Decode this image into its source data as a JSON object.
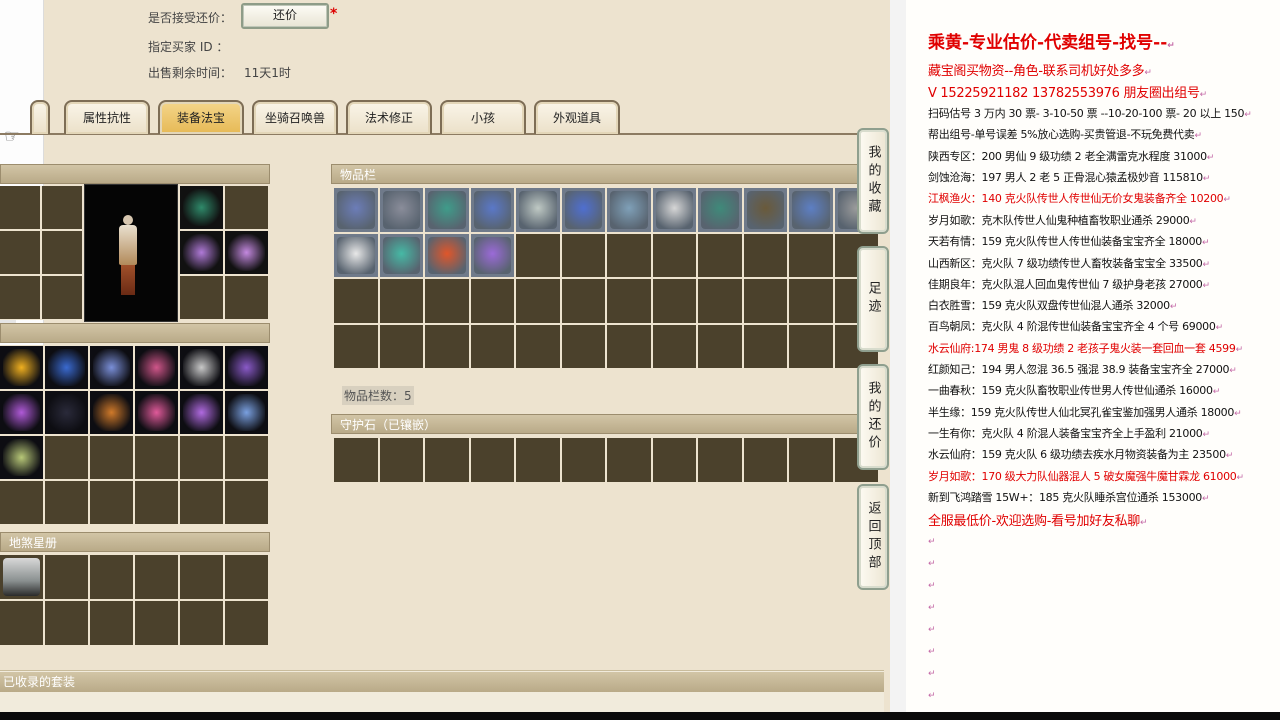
{
  "top_info": {
    "accept_counter_label": "是否接受还价：",
    "counter_button": "还价",
    "required_mark": "*",
    "buyer_id_label": "指定买家 ID ：",
    "time_left_label": "出售剩余时间：",
    "time_left_value": "11天1时"
  },
  "tabs": [
    "属性抗性",
    "装备法宝",
    "坐骑召唤兽",
    "法术修正",
    "小孩",
    "外观道具"
  ],
  "active_tab": "装备法宝",
  "panels": {
    "inventory_title": "物品栏",
    "inventory_count_label": "物品栏数：5",
    "guard_stone_title": "守护石（已镶嵌）",
    "earth_sha_title": "地煞星册",
    "collected_sets_title": "已收录的套装"
  },
  "side_buttons": [
    "我的收藏",
    "足迹",
    "我的还价",
    "返回顶部"
  ],
  "item_colors": {
    "inventory": [
      "#6c7db8",
      "#8a8d9a",
      "#3f9c8a",
      "#5a78c8",
      "#bfc9c4",
      "#4f6fd0",
      "#7fa0b8",
      "#d6d6d6",
      "#3f8a7a",
      "#6a5a3a",
      "#5d7fc4",
      "#9c9c9c",
      "#e8e8e8",
      "#46b9a5",
      "#e0562a",
      "#9b6ad8"
    ],
    "equipped": [
      "#2f8a6a",
      "#b07ad8",
      "#c489e0"
    ],
    "treasures": [
      "#f0b020",
      "#3a6ad0",
      "#7a8fd8",
      "#d0568a",
      "#c8c8c8",
      "#8a5ac8",
      "#b05ad8",
      "#2a2a3a",
      "#d07a2a",
      "#e05a9a",
      "#b06ae0",
      "#7aa0e0",
      "#b8c878"
    ],
    "star_book": [
      "#8a9090"
    ]
  },
  "notes": {
    "title": "乘黄-专业估价-代卖组号-找号--",
    "lines": [
      {
        "text": "藏宝阁买物资--角色-联系司机好处多多",
        "style": "mid"
      },
      {
        "text": "V 15225921182   13782553976 朋友圈出组号",
        "style": "mid"
      },
      {
        "text": "扫码估号 3 万内 30 票- 3-10-50 票  --10-20-100 票- 20 以上 150",
        "style": "normal"
      },
      {
        "text": "帮出组号-单号误差 5%放心选购-买贵管退-不玩免费代卖",
        "style": "normal"
      },
      {
        "text": "陕西专区：200 男仙 9 级功绩 2 老全满雷克水程度 31000",
        "style": "normal"
      },
      {
        "text": "剑蚀沧海：197 男人 2 老 5 正骨混心猿孟极妙音 115810",
        "style": "normal"
      },
      {
        "text": "江枫渔火：140 克火队传世人传世仙无价女鬼装备齐全 10200",
        "style": "red"
      },
      {
        "text": "岁月如歌：克木队传世人仙鬼种植畜牧职业通杀 29000",
        "style": "normal"
      },
      {
        "text": "天若有情：159 克火队传世人传世仙装备宝宝齐全 18000",
        "style": "normal"
      },
      {
        "text": "山西新区：克火队 7 级功绩传世人畜牧装备宝宝全 33500",
        "style": "normal"
      },
      {
        "text": "佳期良年：克火队混人回血鬼传世仙 7 级护身老孩 27000",
        "style": "normal"
      },
      {
        "text": "白衣胜雪：159 克火队双盘传世仙混人通杀 32000",
        "style": "normal"
      },
      {
        "text": "百鸟朝凤：克火队 4 阶混传世仙装备宝宝齐全 4 个号 69000",
        "style": "normal"
      },
      {
        "text": "水云仙府:174 男鬼 8 级功绩 2 老孩子鬼火装一套回血一套 4599",
        "style": "red"
      },
      {
        "text": "红颜知己：194 男人忽混 36.5 强混 38.9 装备宝宝齐全 27000",
        "style": "normal"
      },
      {
        "text": "一曲春秋：159 克火队畜牧职业传世男人传世仙通杀 16000",
        "style": "normal"
      },
      {
        "text": "半生缘：159 克火队传世人仙北冥孔雀宝鉴加强男人通杀 18000",
        "style": "normal"
      },
      {
        "text": "一生有你：克火队 4 阶混人装备宝宝齐全上手盈利 21000",
        "style": "normal"
      },
      {
        "text": "水云仙府：159 克火队 6 级功绩去疾水月物资装备为主 23500",
        "style": "normal"
      },
      {
        "text": "岁月如歌：170 级大力队仙器混人 5 破女魔强牛魔甘霖龙 61000",
        "style": "red"
      },
      {
        "text": "新到飞鸿踏雪 15W+：185 克火队睡杀宫位通杀 153000",
        "style": "normal"
      },
      {
        "text": "全服最低价-欢迎选购-看号加好友私聊",
        "style": "mid"
      }
    ],
    "return_mark": "↵"
  }
}
